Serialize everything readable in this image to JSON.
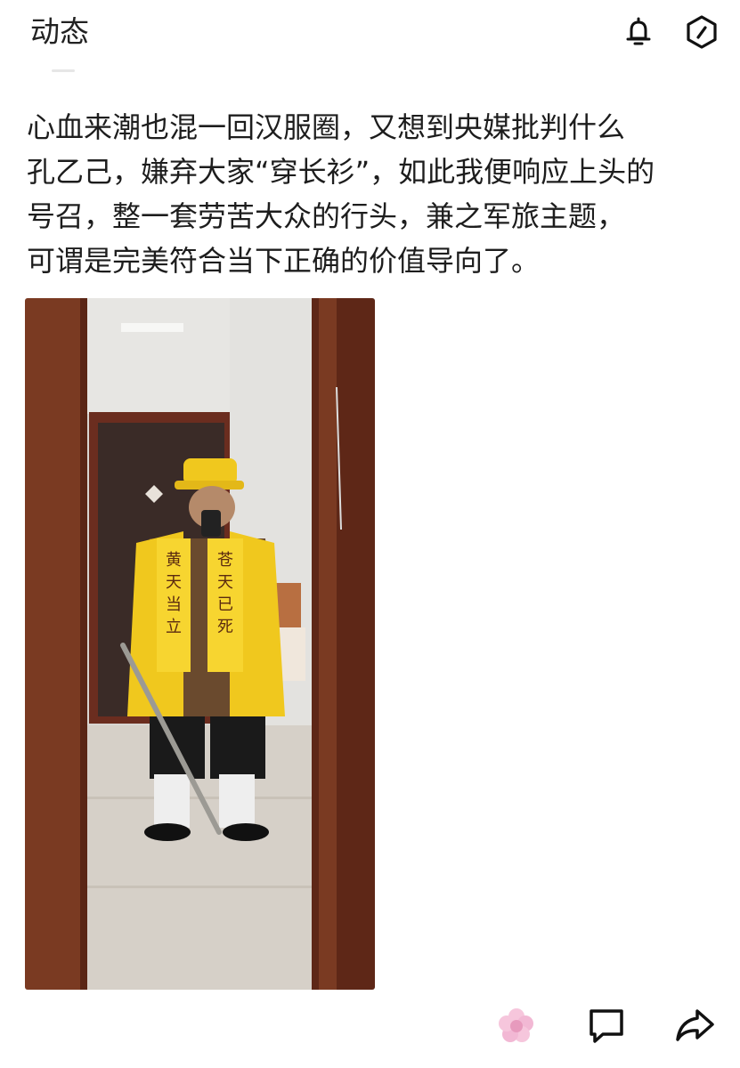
{
  "header": {
    "title": "动态",
    "icons": [
      "bell-icon",
      "hexagon-settings-icon"
    ]
  },
  "post": {
    "text": "心血来潮也混一回汉服圈，又想到央媒批判什么\n孔乙己，嫌弃大家“穿长衫”，如此我便响应上头的\n号召，整一套劳苦大众的行头，兼之军旅主题，\n可谓是完美符合当下正确的价值导向了。",
    "image": {
      "sash_left": "黄天当立",
      "sash_right": "苍天已死"
    }
  },
  "actions": {
    "icons": [
      "flower-sticker-icon",
      "comment-icon",
      "share-icon"
    ]
  },
  "colors": {
    "accent_yellow": "#f0c81e",
    "door_wood": "#7a3a22",
    "text": "#1d1d1d"
  }
}
